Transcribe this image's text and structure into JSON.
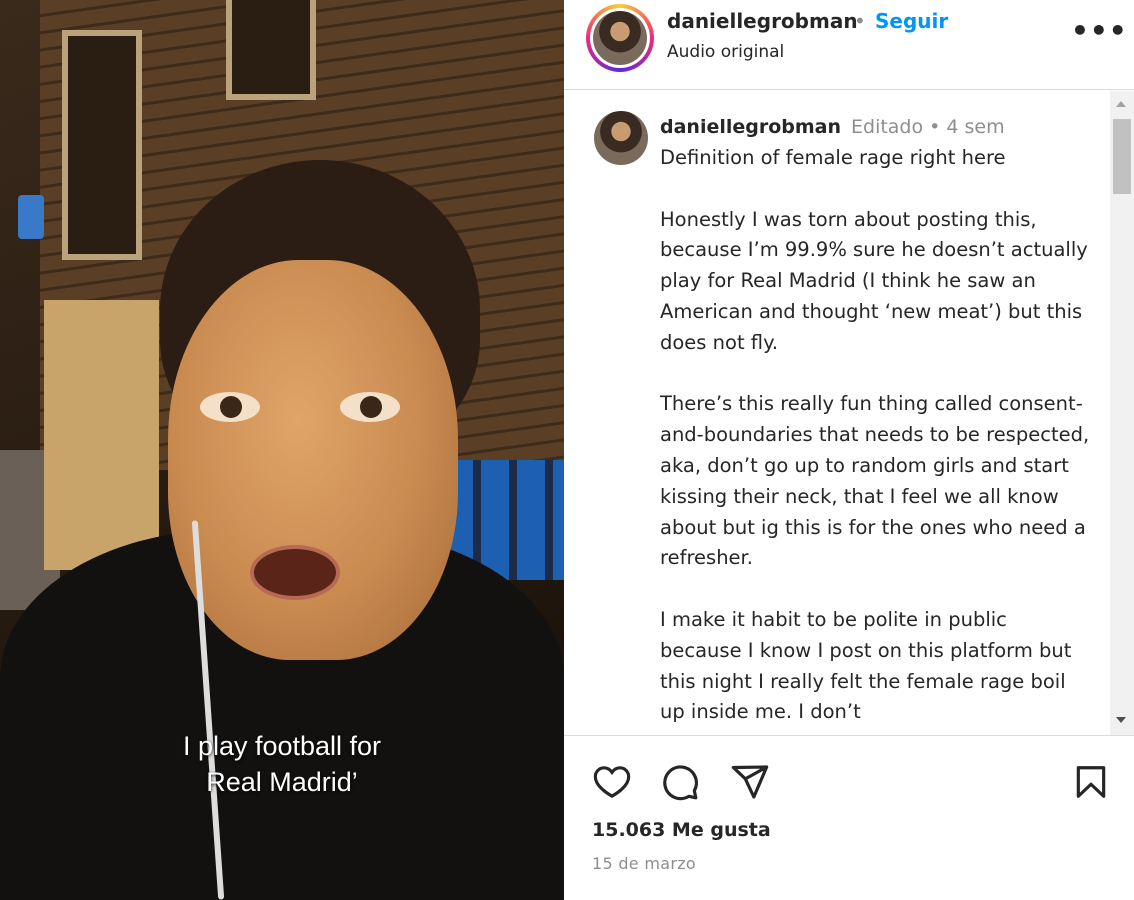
{
  "video": {
    "caption_line1": "I play football for",
    "caption_line2": "Real Madrid’"
  },
  "header": {
    "username": "daniellegrobman",
    "separator": "•",
    "follow_label": "Seguir",
    "audio_label": "Audio original",
    "more_label": "•••"
  },
  "post": {
    "username": "daniellegrobman",
    "meta": "Editado • 4 sem",
    "caption": "Definition of female rage right here\n\nHonestly I was torn about posting this, because I’m 99.9% sure he doesn’t actually play for Real Madrid (I think he saw an American and thought ‘new meat’) but this does not fly.\n\nThere’s this really fun thing called consent-and-boundaries that needs to be respected, aka, don’t go up to random girls and start kissing their neck, that I feel we all know about but ig this is for the ones who need a refresher.\n\nI make it habit to be polite in public because I know I post on this platform but this night I really felt the female rage boil up inside me. I don’t"
  },
  "actions": {
    "like_icon": "heart-icon",
    "comment_icon": "comment-icon",
    "share_icon": "send-icon",
    "save_icon": "bookmark-icon",
    "likes_text": "15.063 Me gusta",
    "date_text": "15 de marzo"
  },
  "colors": {
    "follow_blue": "#0095f6",
    "muted_text": "#8e8e8e",
    "text": "#262626"
  }
}
